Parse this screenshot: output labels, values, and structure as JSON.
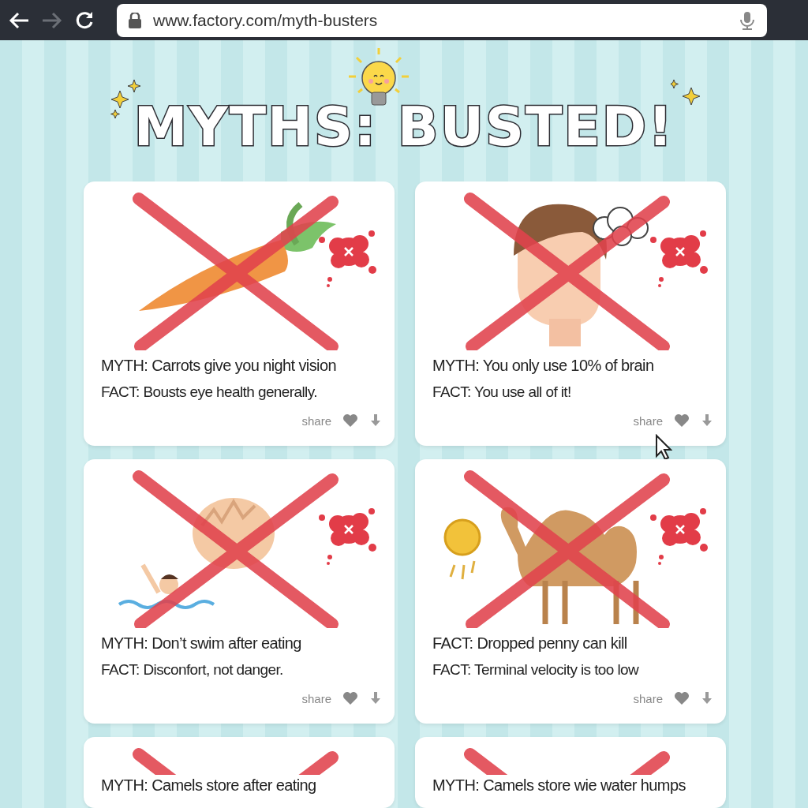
{
  "browser": {
    "url": "www.factory.com/myth-busters"
  },
  "title": "MYTHS: BUSTED!",
  "cards": [
    {
      "kind": "carrot",
      "lines": [
        "MYTH: Carrots give you night vision",
        "FACT: Bousts eye health generally."
      ],
      "share": "share",
      "hovered": false
    },
    {
      "kind": "head",
      "lines": [
        "MYTH: You only use 10% of brain",
        "FACT: You use all of it!"
      ],
      "share": "share",
      "hovered": true
    },
    {
      "kind": "swimmer",
      "lines": [
        "MYTH: Don’t swim after eating",
        "FACT: Disconfort, not danger."
      ],
      "share": "share",
      "hovered": false
    },
    {
      "kind": "camel",
      "lines": [
        "FACT: Dropped penny can kill",
        "FACT: Terminal velocity is too low"
      ],
      "share": "share",
      "hovered": false
    },
    {
      "kind": "partial",
      "lines": [
        "MYTH: Camels store after eating"
      ],
      "hovered": false
    },
    {
      "kind": "partial",
      "lines": [
        "MYTH: Camels store wie water humps"
      ],
      "hovered": false
    }
  ]
}
